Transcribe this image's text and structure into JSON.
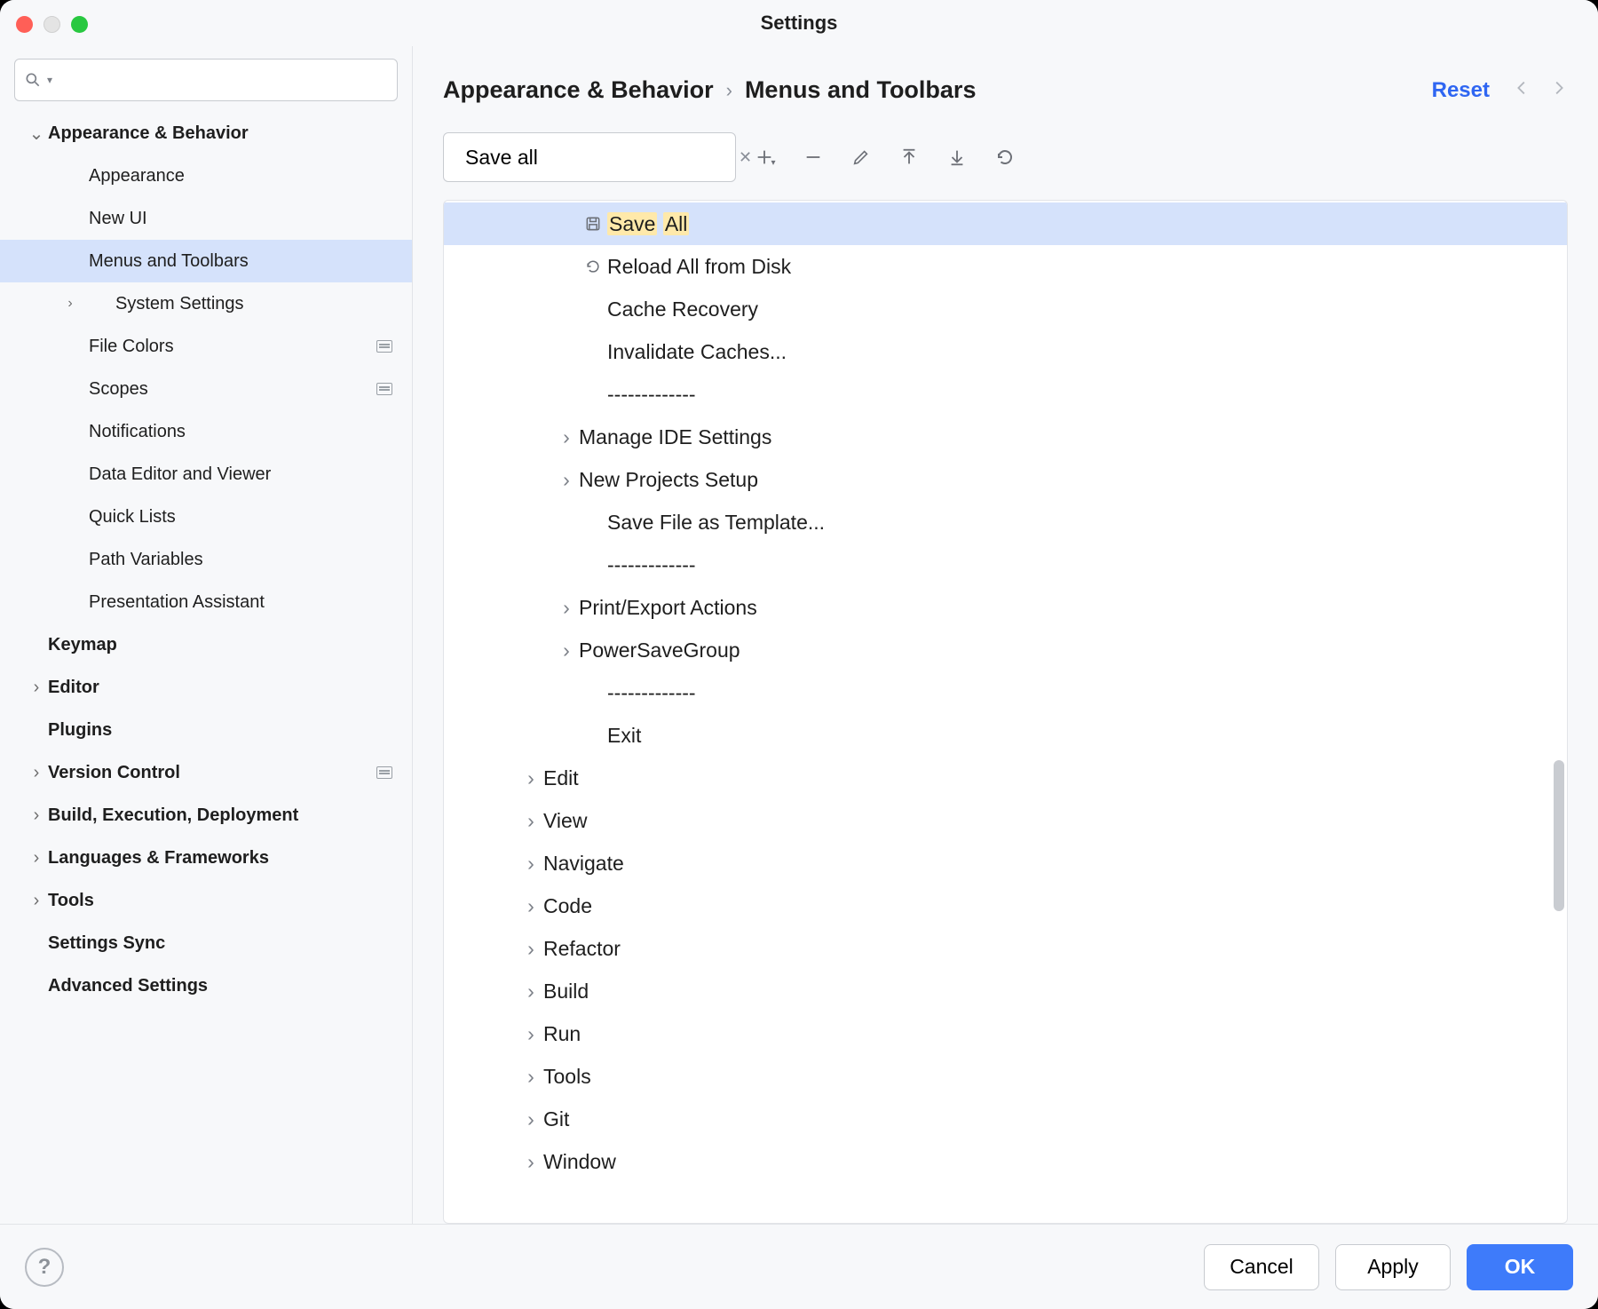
{
  "window": {
    "title": "Settings"
  },
  "sidebar": {
    "search_placeholder": "",
    "items": [
      {
        "label": "Appearance & Behavior",
        "bold": true,
        "depth": 0,
        "chev": "down"
      },
      {
        "label": "Appearance",
        "depth": 1
      },
      {
        "label": "New UI",
        "depth": 1
      },
      {
        "label": "Menus and Toolbars",
        "depth": 1,
        "selected": true
      },
      {
        "label": "System Settings",
        "depth": 1,
        "chev": "right"
      },
      {
        "label": "File Colors",
        "depth": 1,
        "badge": true
      },
      {
        "label": "Scopes",
        "depth": 1,
        "badge": true
      },
      {
        "label": "Notifications",
        "depth": 1
      },
      {
        "label": "Data Editor and Viewer",
        "depth": 1
      },
      {
        "label": "Quick Lists",
        "depth": 1
      },
      {
        "label": "Path Variables",
        "depth": 1
      },
      {
        "label": "Presentation Assistant",
        "depth": 1
      },
      {
        "label": "Keymap",
        "bold": true,
        "depth": 0
      },
      {
        "label": "Editor",
        "bold": true,
        "depth": 0,
        "chev": "right"
      },
      {
        "label": "Plugins",
        "bold": true,
        "depth": 0
      },
      {
        "label": "Version Control",
        "bold": true,
        "depth": 0,
        "chev": "right",
        "badge": true
      },
      {
        "label": "Build, Execution, Deployment",
        "bold": true,
        "depth": 0,
        "chev": "right"
      },
      {
        "label": "Languages & Frameworks",
        "bold": true,
        "depth": 0,
        "chev": "right"
      },
      {
        "label": "Tools",
        "bold": true,
        "depth": 0,
        "chev": "right"
      },
      {
        "label": "Settings Sync",
        "bold": true,
        "depth": 0
      },
      {
        "label": "Advanced Settings",
        "bold": true,
        "depth": 0
      }
    ]
  },
  "content": {
    "breadcrumb": [
      "Appearance & Behavior",
      "Menus and Toolbars"
    ],
    "reset_label": "Reset",
    "filter_value": "Save all",
    "toolbar_icons": [
      "add",
      "remove",
      "edit",
      "move-up",
      "move-down",
      "revert"
    ],
    "actions": [
      {
        "kind": "item",
        "indent": 2,
        "icon": "save",
        "label": "Save All",
        "selected": true,
        "highlight_ranges": [
          [
            0,
            4
          ],
          [
            5,
            8
          ]
        ]
      },
      {
        "kind": "item",
        "indent": 2,
        "icon": "reload",
        "label": "Reload All from Disk"
      },
      {
        "kind": "item",
        "indent": 2,
        "label": "Cache Recovery"
      },
      {
        "kind": "item",
        "indent": 2,
        "label": "Invalidate Caches..."
      },
      {
        "kind": "sep",
        "indent": 2,
        "label": "-------------"
      },
      {
        "kind": "group",
        "indent": 2,
        "label": "Manage IDE Settings",
        "chev": "right"
      },
      {
        "kind": "group",
        "indent": 2,
        "label": "New Projects Setup",
        "chev": "right"
      },
      {
        "kind": "item",
        "indent": 2,
        "label": "Save File as Template..."
      },
      {
        "kind": "sep",
        "indent": 2,
        "label": "-------------"
      },
      {
        "kind": "group",
        "indent": 2,
        "label": "Print/Export Actions",
        "chev": "right"
      },
      {
        "kind": "group",
        "indent": 2,
        "label": "PowerSaveGroup",
        "chev": "right"
      },
      {
        "kind": "sep",
        "indent": 2,
        "label": "-------------"
      },
      {
        "kind": "item",
        "indent": 2,
        "label": "Exit"
      },
      {
        "kind": "group",
        "indent": 1,
        "label": "Edit",
        "chev": "right"
      },
      {
        "kind": "group",
        "indent": 1,
        "label": "View",
        "chev": "right"
      },
      {
        "kind": "group",
        "indent": 1,
        "label": "Navigate",
        "chev": "right"
      },
      {
        "kind": "group",
        "indent": 1,
        "label": "Code",
        "chev": "right"
      },
      {
        "kind": "group",
        "indent": 1,
        "label": "Refactor",
        "chev": "right"
      },
      {
        "kind": "group",
        "indent": 1,
        "label": "Build",
        "chev": "right"
      },
      {
        "kind": "group",
        "indent": 1,
        "label": "Run",
        "chev": "right"
      },
      {
        "kind": "group",
        "indent": 1,
        "label": "Tools",
        "chev": "right"
      },
      {
        "kind": "group",
        "indent": 1,
        "label": "Git",
        "chev": "right"
      },
      {
        "kind": "group",
        "indent": 1,
        "label": "Window",
        "chev": "right"
      }
    ]
  },
  "footer": {
    "cancel": "Cancel",
    "apply": "Apply",
    "ok": "OK"
  }
}
